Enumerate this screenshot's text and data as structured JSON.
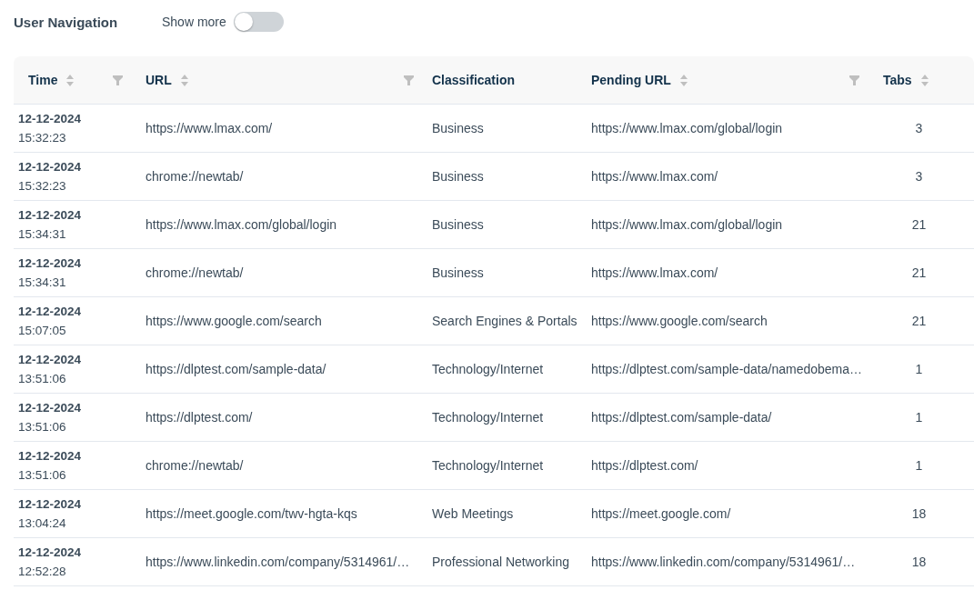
{
  "header": {
    "title": "User Navigation",
    "toggle": {
      "label": "Show more",
      "on": false
    }
  },
  "table": {
    "columns": [
      {
        "label": "Time",
        "sortable": true,
        "filterable": true
      },
      {
        "label": "URL",
        "sortable": true,
        "filterable": true
      },
      {
        "label": "Classification",
        "sortable": false,
        "filterable": false
      },
      {
        "label": "Pending URL",
        "sortable": true,
        "filterable": true
      },
      {
        "label": "Tabs",
        "sortable": true,
        "filterable": false
      }
    ],
    "rows": [
      {
        "date": "12-12-2024",
        "time": "15:32:23",
        "url": "https://www.lmax.com/",
        "classification": "Business",
        "pending_url": "https://www.lmax.com/global/login",
        "tabs": "3"
      },
      {
        "date": "12-12-2024",
        "time": "15:32:23",
        "url": "chrome://newtab/",
        "classification": "Business",
        "pending_url": "https://www.lmax.com/",
        "tabs": "3"
      },
      {
        "date": "12-12-2024",
        "time": "15:34:31",
        "url": "https://www.lmax.com/global/login",
        "classification": "Business",
        "pending_url": "https://www.lmax.com/global/login",
        "tabs": "21"
      },
      {
        "date": "12-12-2024",
        "time": "15:34:31",
        "url": "chrome://newtab/",
        "classification": "Business",
        "pending_url": "https://www.lmax.com/",
        "tabs": "21"
      },
      {
        "date": "12-12-2024",
        "time": "15:07:05",
        "url": "https://www.google.com/search",
        "classification": "Search Engines & Portals",
        "pending_url": "https://www.google.com/search",
        "tabs": "21"
      },
      {
        "date": "12-12-2024",
        "time": "13:51:06",
        "url": "https://dlptest.com/sample-data/",
        "classification": "Technology/Internet",
        "pending_url": "https://dlptest.com/sample-data/namedobema…",
        "tabs": "1"
      },
      {
        "date": "12-12-2024",
        "time": "13:51:06",
        "url": "https://dlptest.com/",
        "classification": "Technology/Internet",
        "pending_url": "https://dlptest.com/sample-data/",
        "tabs": "1"
      },
      {
        "date": "12-12-2024",
        "time": "13:51:06",
        "url": "chrome://newtab/",
        "classification": "Technology/Internet",
        "pending_url": "https://dlptest.com/",
        "tabs": "1"
      },
      {
        "date": "12-12-2024",
        "time": "13:04:24",
        "url": "https://meet.google.com/twv-hgta-kqs",
        "classification": "Web Meetings",
        "pending_url": "https://meet.google.com/",
        "tabs": "18"
      },
      {
        "date": "12-12-2024",
        "time": "12:52:28",
        "url": "https://www.linkedin.com/company/5314961/…",
        "classification": "Professional Networking",
        "pending_url": "https://www.linkedin.com/company/5314961/…",
        "tabs": "18"
      }
    ]
  }
}
